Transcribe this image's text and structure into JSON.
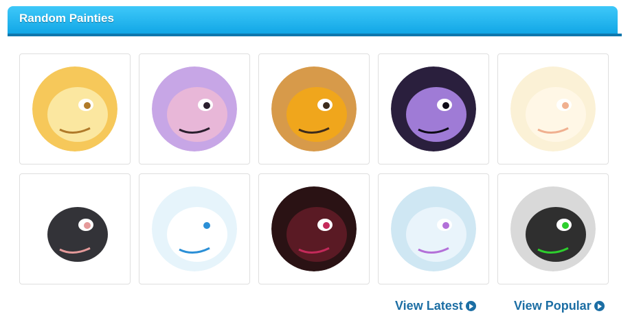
{
  "header": {
    "title": "Random Painties"
  },
  "avatars": [
    {
      "icon": "yellow-dragon-avatar",
      "bg": "#f6c85a",
      "fg": "#fbe7a0",
      "accent": "#b07a2a"
    },
    {
      "icon": "pink-pony-avatar",
      "bg": "#c7a6e6",
      "fg": "#e8b7d8",
      "accent": "#2a1f2e"
    },
    {
      "icon": "orange-horned-dragon-avatar",
      "bg": "#d79a4a",
      "fg": "#f0a61c",
      "accent": "#3d2b1b"
    },
    {
      "icon": "crystal-dark-creature-avatar",
      "bg": "#2a1f3d",
      "fg": "#9f7bd6",
      "accent": "#0e0b17"
    },
    {
      "icon": "pale-cat-avatar",
      "bg": "#fbf1d6",
      "fg": "#fff7e6",
      "accent": "#f0b090"
    },
    {
      "icon": "black-rat-avatar",
      "bg": "#ffffff",
      "fg": "#333338",
      "accent": "#e59a9a"
    },
    {
      "icon": "blue-white-cat-avatar",
      "bg": "#e6f4fb",
      "fg": "#ffffff",
      "accent": "#2b8fd6"
    },
    {
      "icon": "dark-red-dragon-avatar",
      "bg": "#2a1214",
      "fg": "#5a1a24",
      "accent": "#c42a5a"
    },
    {
      "icon": "blue-furry-creature-avatar",
      "bg": "#cfe7f3",
      "fg": "#e9f4fb",
      "accent": "#b370d8"
    },
    {
      "icon": "green-black-lizard-avatar",
      "bg": "#d9d9d9",
      "fg": "#2f2f2f",
      "accent": "#2dcf2d"
    }
  ],
  "links": {
    "latest_label": "View Latest",
    "popular_label": "View Popular"
  }
}
